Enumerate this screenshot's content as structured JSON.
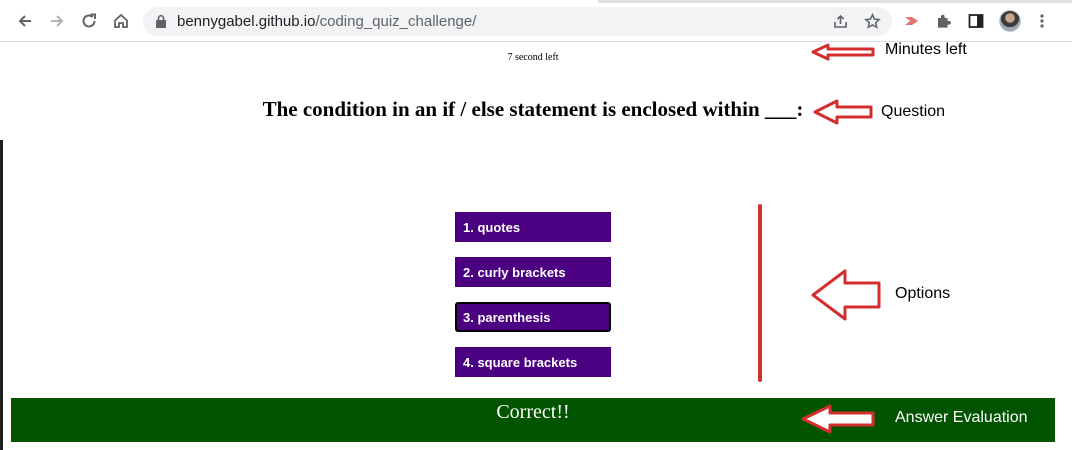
{
  "browser": {
    "url_host": "bennygabel.github.io",
    "url_path": "/coding_quiz_challenge/",
    "icons": [
      "back-icon",
      "forward-icon",
      "reload-icon",
      "home-icon",
      "lock-icon",
      "share-icon",
      "bookmark-star-icon",
      "extension-icon",
      "puzzle-icon",
      "side-panel-icon",
      "avatar",
      "kebab-menu-icon"
    ],
    "colors": {
      "omnibox_bg": "#f1f3f4",
      "extension_accent": "#e57373"
    }
  },
  "quiz": {
    "timer": "7 second left",
    "question": "The condition in an if / else statement is enclosed within ___:",
    "options": [
      "1. quotes",
      "2. curly brackets",
      "3. parenthesis",
      "4. square brackets"
    ],
    "evaluation": "Correct!!",
    "colors": {
      "option_bg": "#4b0082",
      "evaluation_bg": "#005400"
    }
  },
  "annotations": {
    "minutes_left": "Minutes left",
    "question": "Question",
    "options": "Options",
    "answer_evaluation": "Answer Evaluation",
    "color": "#d32f2f"
  }
}
